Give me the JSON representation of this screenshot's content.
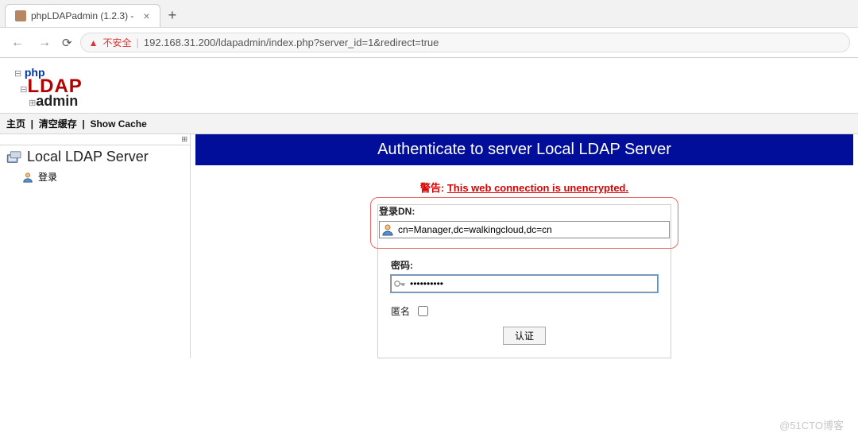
{
  "browser": {
    "tab_title": "phpLDAPadmin (1.2.3) -",
    "insecure_label": "不安全",
    "url": "192.168.31.200/ldapadmin/index.php?server_id=1&redirect=true"
  },
  "logo": {
    "line1": "php",
    "line2": "LDAP",
    "line3": "admin"
  },
  "toolbar": {
    "home": "主页",
    "clear_cache": "清空缓存",
    "show_cache": "Show Cache"
  },
  "sidebar": {
    "server_name": "Local LDAP Server",
    "login_label": "登录"
  },
  "main": {
    "header": "Authenticate to server Local LDAP Server",
    "warning_prefix": "警告:",
    "warning_msg": "This web connection is unencrypted.",
    "dn_label": "登录DN:",
    "dn_value": "cn=Manager,dc=walkingcloud,dc=cn",
    "pw_label": "密码:",
    "pw_value": "••••••••••",
    "anon_label": "匿名",
    "submit_label": "认证"
  },
  "watermark": "@51CTO博客"
}
